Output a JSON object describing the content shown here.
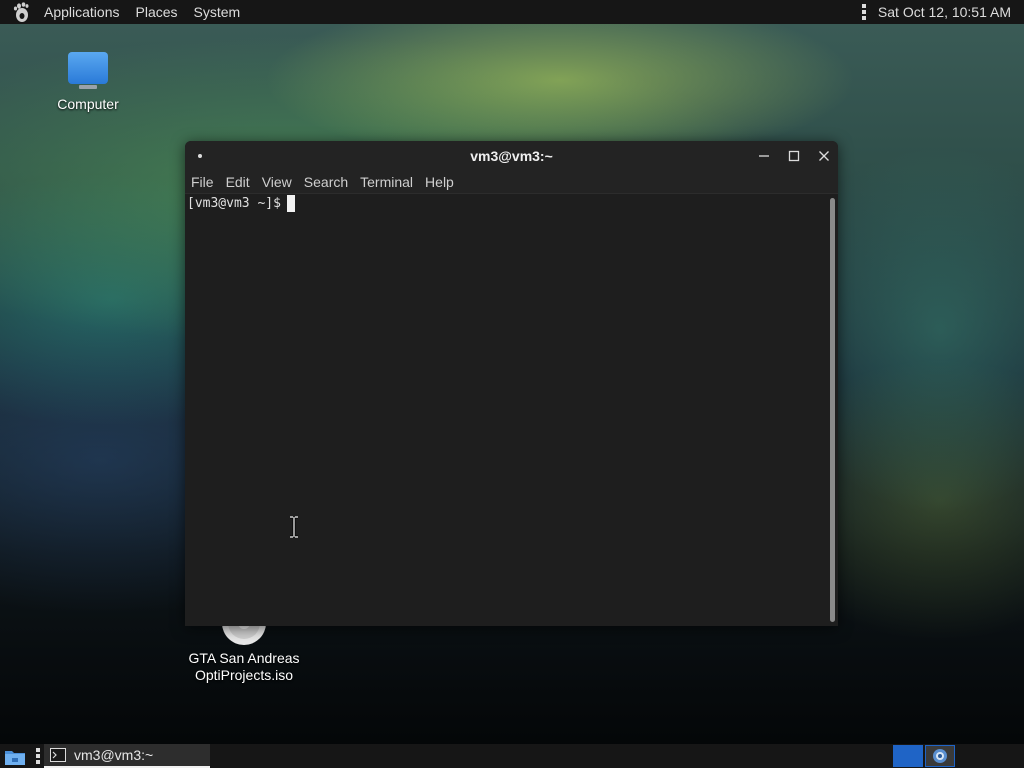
{
  "top_panel": {
    "menus": [
      "Applications",
      "Places",
      "System"
    ],
    "clock": "Sat Oct 12, 10:51 AM"
  },
  "desktop": {
    "icons": [
      {
        "label_lines": [
          "Computer"
        ],
        "icon": "computer-icon"
      },
      {
        "label_lines": [
          "GTA San Andreas",
          "OptiProjects.iso"
        ],
        "icon": "disc-icon"
      }
    ]
  },
  "terminal": {
    "title": "vm3@vm3:~",
    "menu": [
      "File",
      "Edit",
      "View",
      "Search",
      "Terminal",
      "Help"
    ],
    "prompt": "[vm3@vm3 ~]$"
  },
  "taskbar": {
    "task_label": "vm3@vm3:~",
    "workspace_count": 2,
    "active_workspace": 1
  },
  "colors": {
    "panel": "#161616",
    "window_bg": "#1e1e1e",
    "accent": "#1f64c6"
  }
}
